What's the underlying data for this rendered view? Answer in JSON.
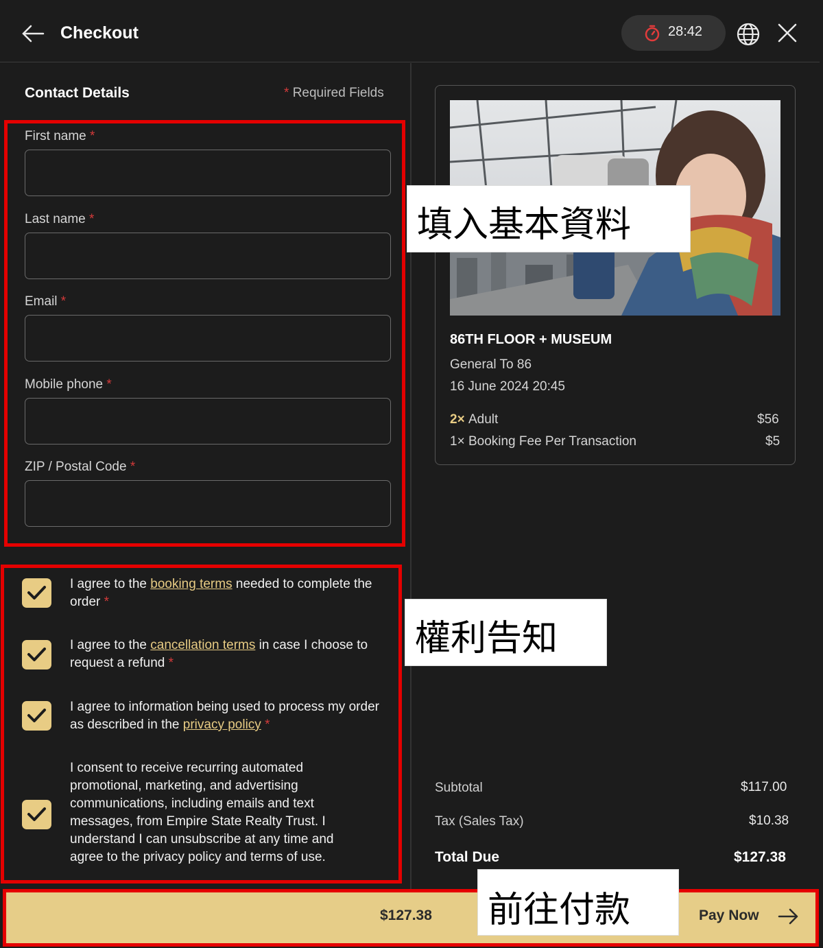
{
  "header": {
    "title": "Checkout",
    "timer": "28:42",
    "icons": {
      "back": "arrow-left-icon",
      "timer": "stopwatch-icon",
      "language": "globe-icon",
      "close": "close-icon"
    }
  },
  "contact": {
    "title": "Contact Details",
    "required_mark": "*",
    "required_note": "Required Fields",
    "fields": [
      {
        "label": "First name",
        "value": ""
      },
      {
        "label": "Last name",
        "value": ""
      },
      {
        "label": "Email",
        "value": ""
      },
      {
        "label": "Mobile phone",
        "value": ""
      },
      {
        "label": "ZIP / Postal Code",
        "value": ""
      }
    ]
  },
  "consents": [
    {
      "pre": "I agree to the ",
      "link": "booking terms",
      "post": " needed to complete the order",
      "required": true,
      "checked": true
    },
    {
      "pre": "I agree to the ",
      "link": "cancellation terms",
      "post": " in case I choose to request a refund",
      "required": true,
      "checked": true
    },
    {
      "pre": "I agree to information being used to process my order as described in the ",
      "link": "privacy policy",
      "post": "",
      "required": true,
      "checked": true
    },
    {
      "pre": "I consent to receive recurring automated promotional, marketing, and advertising communications, including emails and text messages, from Empire State Realty Trust. I understand I can unsubscribe at any time and agree to the privacy policy and terms of use.",
      "link": "",
      "post": "",
      "required": false,
      "checked": true
    }
  ],
  "order": {
    "product": "86TH FLOOR + MUSEUM",
    "ticket_type": "General To 86",
    "date_time": "16 June 2024 20:45",
    "lines": [
      {
        "qty": "2×",
        "name": "Adult",
        "price": "$56"
      },
      {
        "qty": "1×",
        "name": "Booking Fee Per Transaction",
        "price": "$5"
      }
    ]
  },
  "totals": {
    "subtotal_label": "Subtotal",
    "subtotal": "$117.00",
    "tax_label": "Tax (Sales Tax)",
    "tax": "$10.38",
    "total_label": "Total Due",
    "total": "$127.38"
  },
  "pay": {
    "amount": "$127.38",
    "label": "Pay Now",
    "icon": "arrow-right-icon"
  },
  "annotations": {
    "contact": "填入基本資料",
    "rights": "權利告知",
    "pay": "前往付款"
  },
  "colors": {
    "accent": "#e8cc84",
    "required": "#d43a3a",
    "highlight_box": "#e50000",
    "background": "#1c1c1c"
  }
}
